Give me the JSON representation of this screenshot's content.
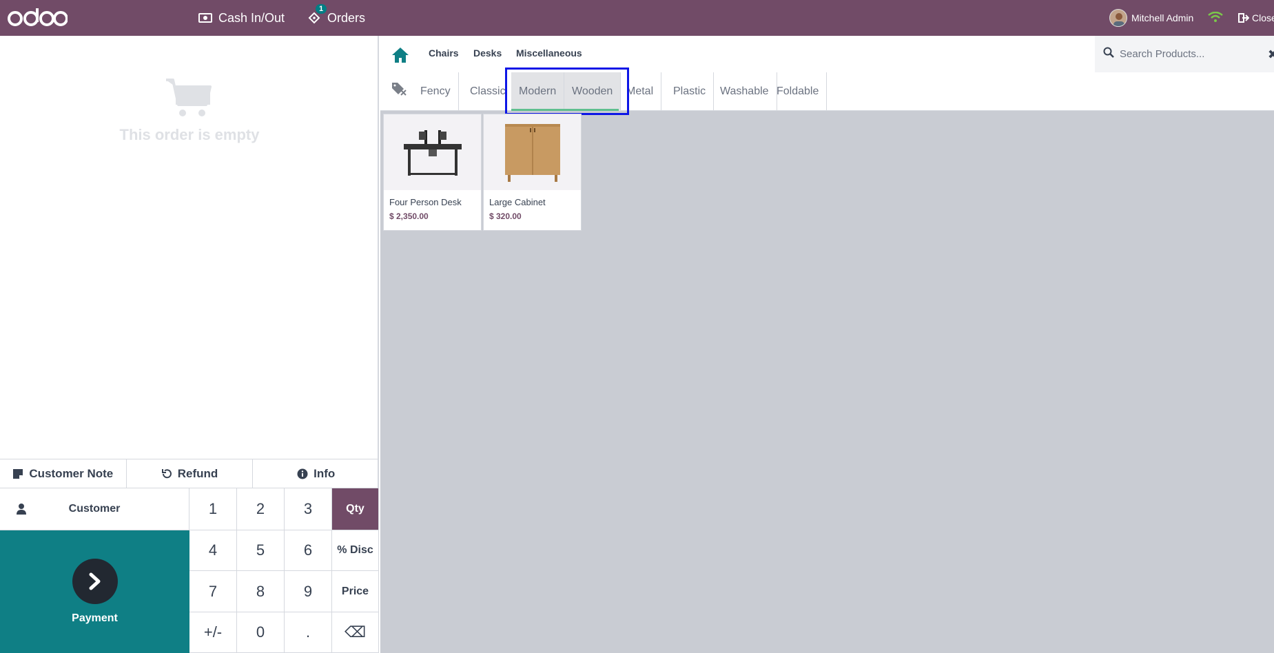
{
  "navbar": {
    "logo": "odoo",
    "cash_label": "Cash In/Out",
    "orders_label": "Orders",
    "orders_badge": "1",
    "user_name": "Mitchell Admin",
    "close_label": "Close",
    "wifi_color": "#7bc84a"
  },
  "order": {
    "empty_text": "This order is empty"
  },
  "controls": {
    "customer_note": "Customer Note",
    "refund": "Refund",
    "info": "Info"
  },
  "customer_label": "Customer",
  "payment_label": "Payment",
  "numpad": {
    "keys": [
      "1",
      "2",
      "3",
      "Qty",
      "4",
      "5",
      "6",
      "% Disc",
      "7",
      "8",
      "9",
      "Price",
      "+/-",
      "0",
      ".",
      "⌫"
    ],
    "active_mode": "Qty"
  },
  "categories": {
    "items": [
      "Chairs",
      "Desks",
      "Miscellaneous"
    ]
  },
  "search": {
    "placeholder": "Search Products..."
  },
  "tags": {
    "items": [
      "Fency",
      "Classic",
      "Modern",
      "Wooden",
      "Metal",
      "Plastic",
      "Washable",
      "Foldable"
    ],
    "selected": [
      "Modern",
      "Wooden"
    ]
  },
  "products": [
    {
      "name": "Four Person Desk",
      "price": "$ 2,350.00"
    },
    {
      "name": "Large Cabinet",
      "price": "$ 320.00"
    }
  ],
  "colors": {
    "brand": "#714B67",
    "payment": "#0f7f85",
    "home_icon": "#0f7f85",
    "highlight_box": "#0d16e6"
  }
}
